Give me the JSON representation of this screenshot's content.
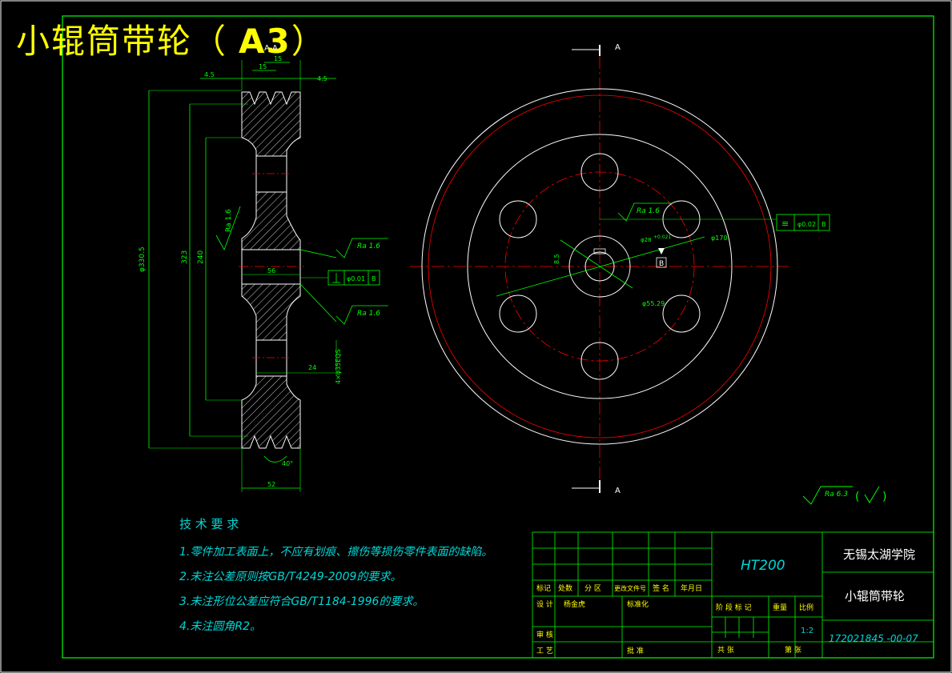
{
  "title": {
    "main": "小辊筒带轮（",
    "size": "A3",
    "close": "）"
  },
  "section_label": "A-A",
  "cut_label": "A",
  "material": "HT200",
  "school": "无锡太湖学院",
  "part_name": "小辊筒带轮",
  "drawing_no": "172021845 -00-07",
  "scale": "1:2",
  "tech_requirements": {
    "heading": "技 术 要 求",
    "items": [
      "1.零件加工表面上，不应有划痕、擦伤等损伤零件表面的缺陷。",
      "2.未注公差原则按GB/T4249-2009的要求。",
      "3.未注形位公差应符合GB/T1184-1996的要求。",
      "4.未注圆角R2。"
    ]
  },
  "title_block": {
    "c_mark": "标记",
    "c_count": "处数",
    "c_zone": "分 区",
    "c_docno": "更改文件号",
    "c_sign": "签 名",
    "c_date": "年月日",
    "c_design": "设 计",
    "designer": "杨金虎",
    "c_std": "标准化",
    "c_check": "审 核",
    "c_process": "工 艺",
    "c_approve": "批 准",
    "c_stage": "阶 段 标 记",
    "c_weight": "重量",
    "c_scale": "比例",
    "c_total": "共  张",
    "c_sheet": "第  张"
  },
  "dims": {
    "d1": "4.5",
    "d2": "15",
    "d3": "4.5",
    "d4": "15",
    "d5": "4.5",
    "od": "φ330.5",
    "d_pitch": "323",
    "d_inner": "240",
    "bore_w": "56",
    "web": "24",
    "hole": "4×φ35EQS",
    "width": "52",
    "angle": "40°",
    "hub_d": "φ28",
    "key": "8.5",
    "pcd": "φ170",
    "pcd2": "φ55.29",
    "tol": "+0.021"
  },
  "roughness": {
    "a": "Ra 1.6",
    "b": "Ra 1.6",
    "c": "Ra 1.6",
    "d": "Ra 1.6",
    "e": "Ra 1.6",
    "general": "Ra 6.3",
    "paren_open": "(",
    "paren_close": ")"
  },
  "tolerances": {
    "perp": "φ0.01",
    "perp_ref": "B",
    "sym_mark": "≡",
    "sym_val": "φ0.02",
    "sym_ref": "B",
    "datum": "B"
  },
  "colors": {
    "frame": "#00ff00",
    "outline": "#ffffff",
    "center": "#ff0000",
    "title": "#ffff00",
    "text": "#00d7d7",
    "dim": "#00ff00"
  }
}
